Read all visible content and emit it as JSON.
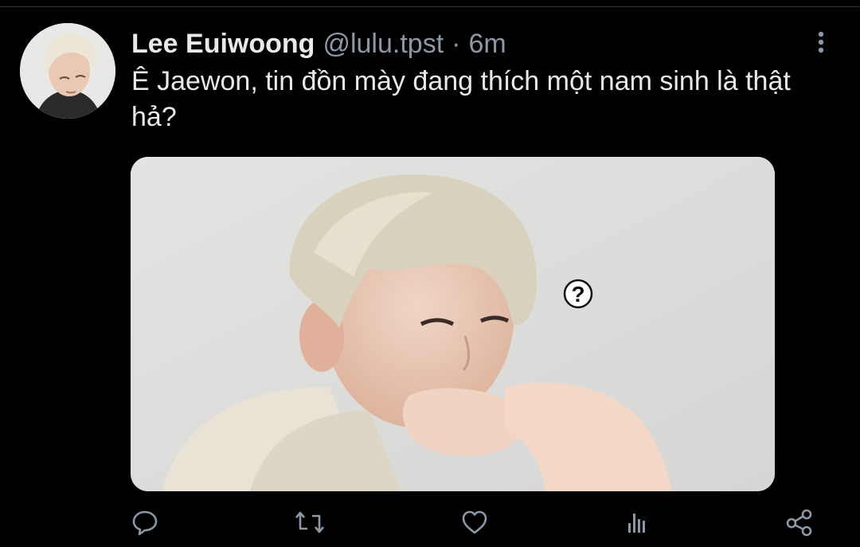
{
  "tweet": {
    "display_name": "Lee Euiwoong",
    "handle": "@lulu.tpst",
    "separator": "·",
    "time": "6m",
    "text": "Ê Jaewon, tin đồn mày đang thích một nam sinh là thật hả?"
  },
  "media": {
    "overlay_glyph": "?"
  },
  "icons": {
    "more": "more-vertical-icon",
    "reply": "reply-icon",
    "retweet": "retweet-icon",
    "like": "heart-icon",
    "analytics": "analytics-icon",
    "share": "share-icon"
  },
  "colors": {
    "background": "#000000",
    "text": "#e7e9ea",
    "secondary": "#8b98a5"
  }
}
